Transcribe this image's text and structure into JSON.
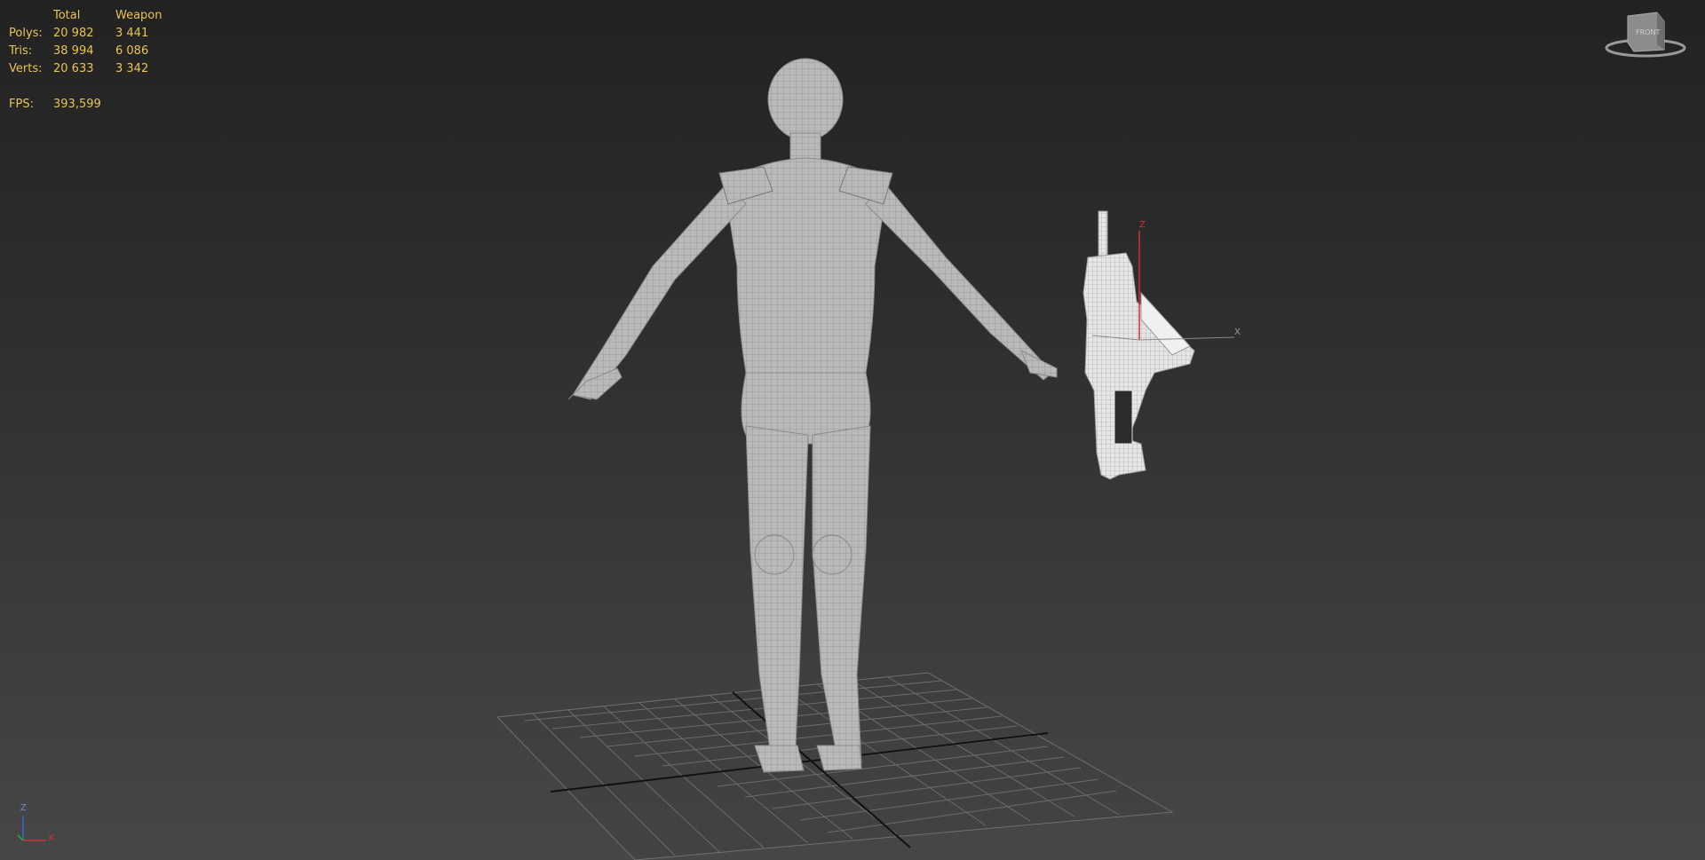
{
  "stats": {
    "headers": [
      "",
      "Total",
      "Weapon"
    ],
    "rows": [
      {
        "label": "Polys:",
        "total": "20 982",
        "weapon": "3 441"
      },
      {
        "label": "Tris:",
        "total": "38 994",
        "weapon": "6 086"
      },
      {
        "label": "Verts:",
        "total": "20 633",
        "weapon": "3 342"
      }
    ],
    "fps_label": "FPS:",
    "fps_value": "393,599"
  },
  "viewcube": {
    "face_label": "FRONT"
  },
  "gizmo": {
    "x_label": "X",
    "z_label": "Z"
  },
  "tripod": {
    "x_label": "X",
    "z_label": "Z"
  },
  "colors": {
    "stats_text": "#e8c456",
    "mesh": "#bdbdbd",
    "wire": "#8a8a8a",
    "grid": "#6a6a6a",
    "axis_x": "#cc3333",
    "axis_z": "#3366cc",
    "axis_y": "#33aa33"
  }
}
